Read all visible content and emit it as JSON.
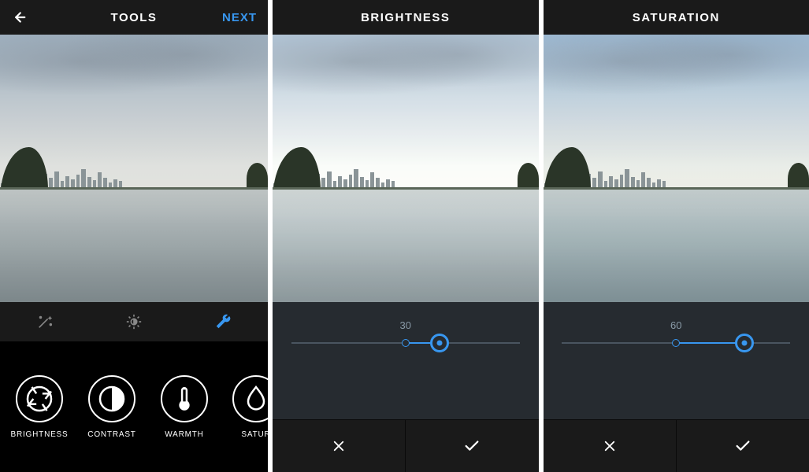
{
  "screen1": {
    "header": {
      "title": "TOOLS",
      "next": "NEXT"
    },
    "tabs": {
      "active_index": 2
    },
    "tools": [
      {
        "label": "BRIGHTNESS",
        "icon": "aperture"
      },
      {
        "label": "CONTRAST",
        "icon": "contrast"
      },
      {
        "label": "WARMTH",
        "icon": "warmth"
      },
      {
        "label": "SATUR",
        "icon": "saturation"
      }
    ]
  },
  "screen2": {
    "header": {
      "title": "BRIGHTNESS"
    },
    "slider": {
      "value": "30",
      "percent": 65
    }
  },
  "screen3": {
    "header": {
      "title": "SATURATION"
    },
    "slider": {
      "value": "60",
      "percent": 80
    }
  },
  "colors": {
    "accent": "#3897f0"
  }
}
